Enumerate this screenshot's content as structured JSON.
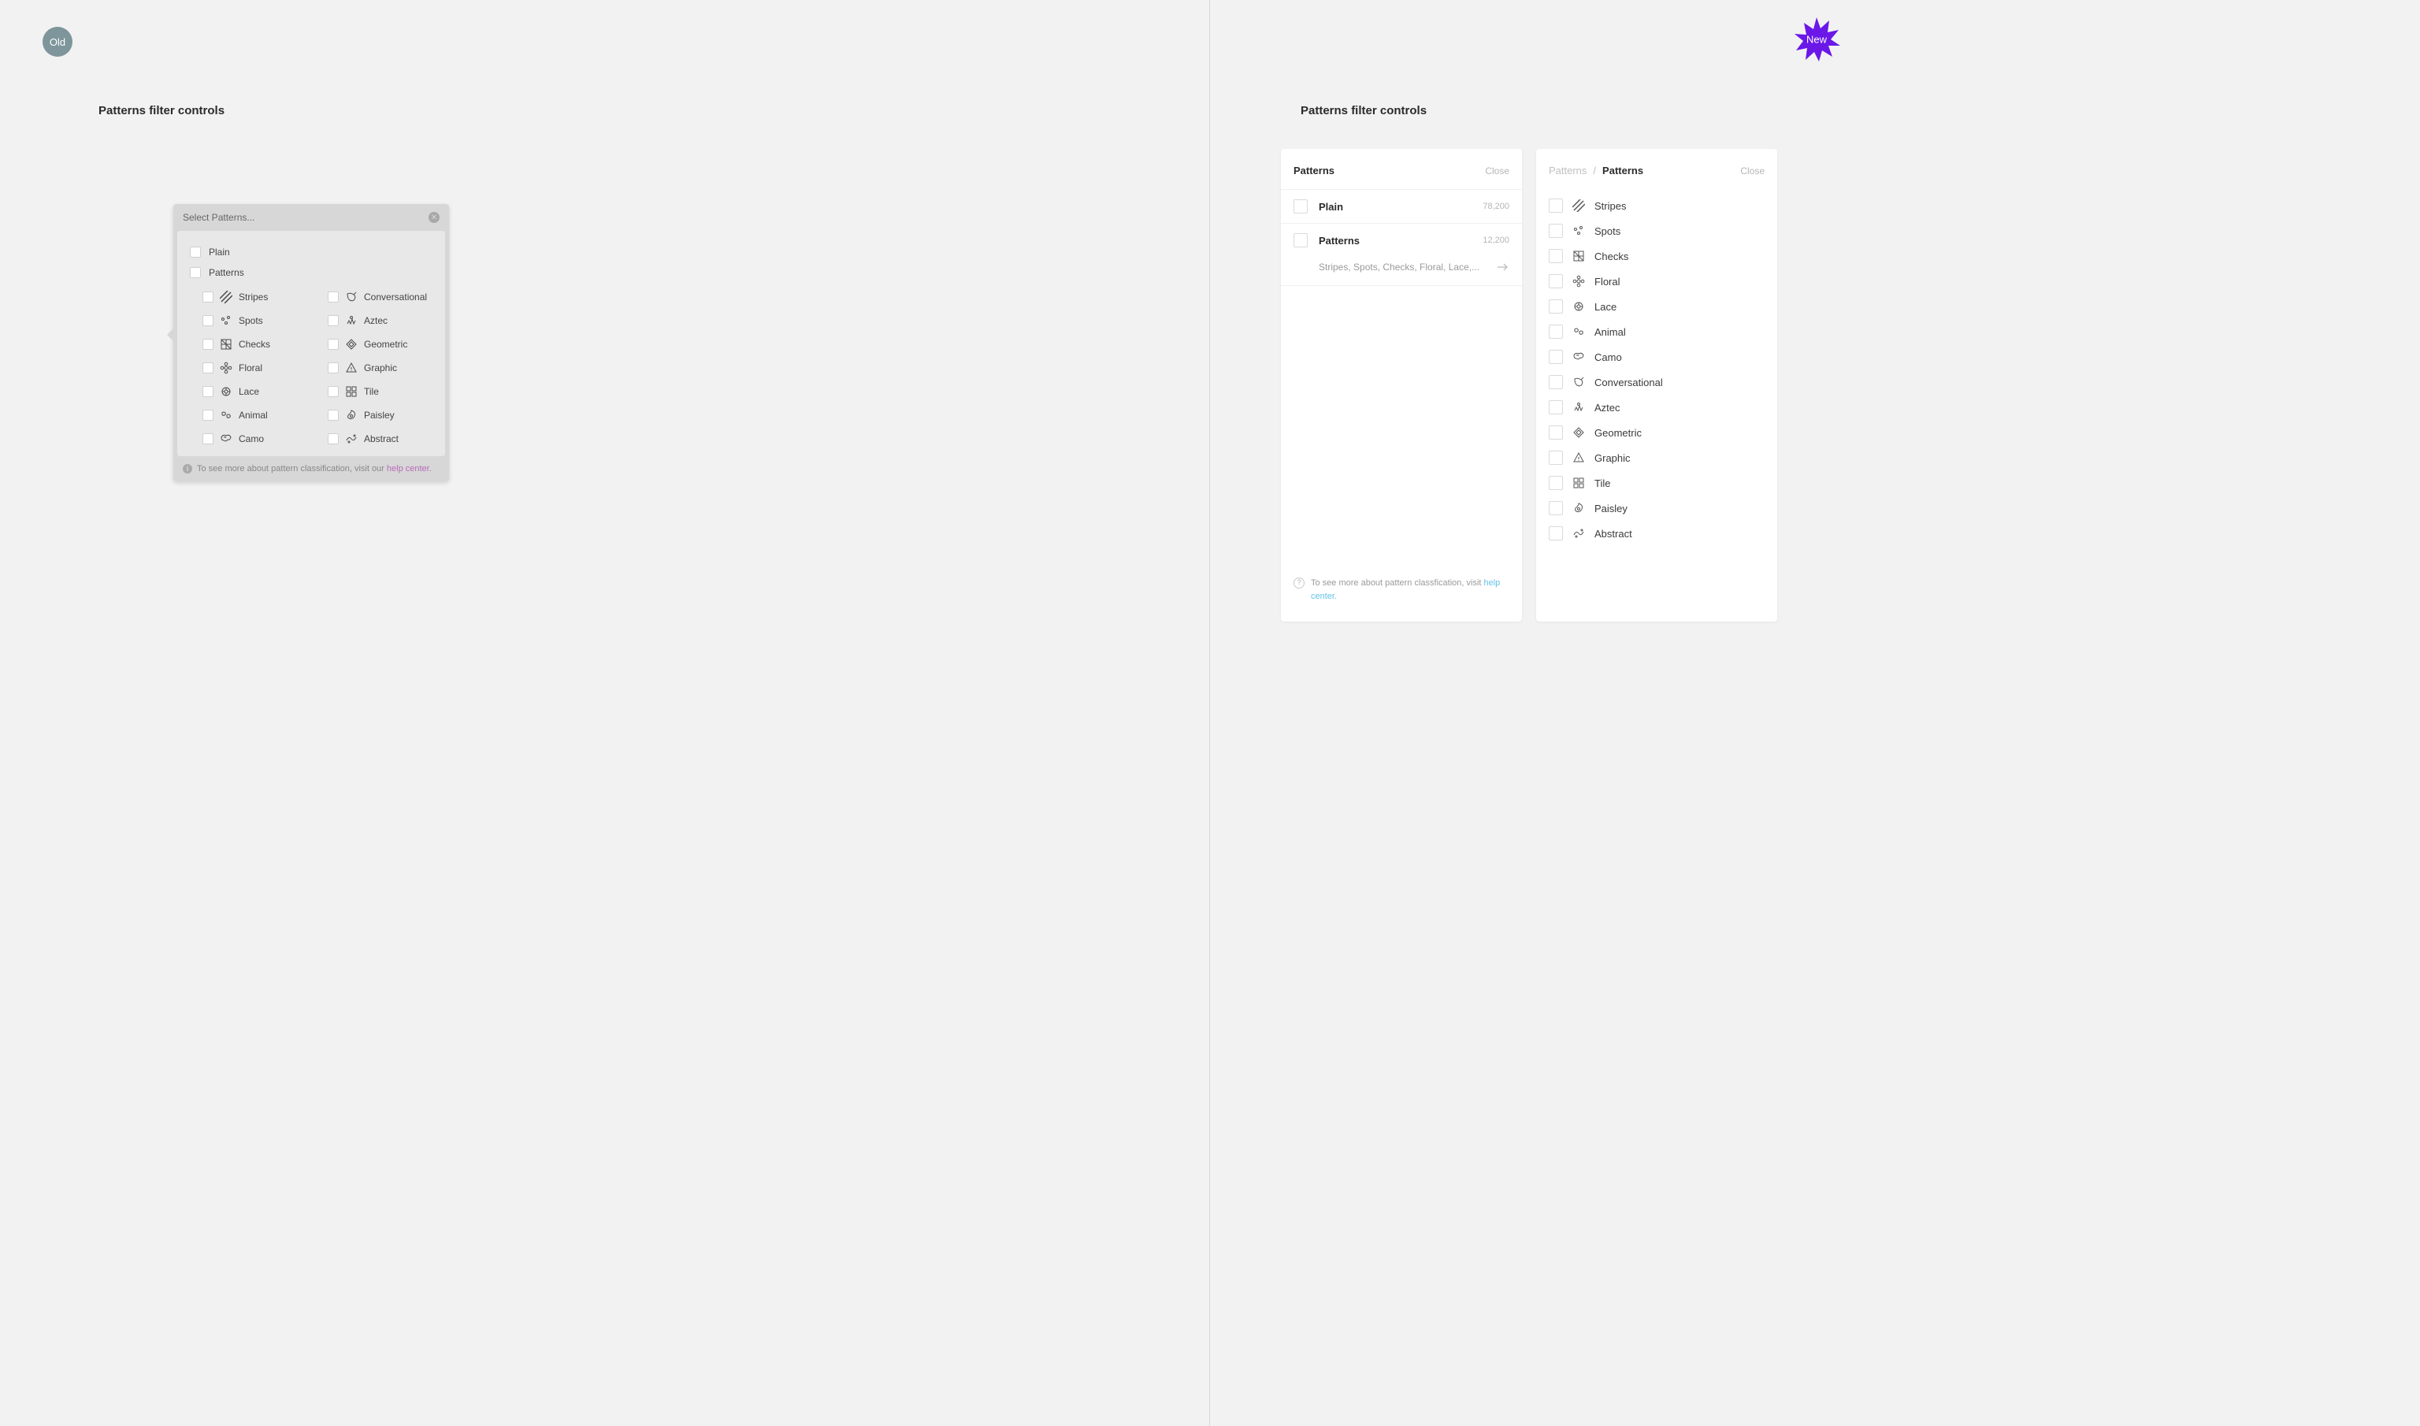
{
  "badges": {
    "old": "Old",
    "new": "New"
  },
  "title": "Patterns filter controls",
  "old_panel": {
    "header": "Select Patterns...",
    "plain": "Plain",
    "patterns": "Patterns",
    "left_col": [
      "Stripes",
      "Spots",
      "Checks",
      "Floral",
      "Lace",
      "Animal",
      "Camo"
    ],
    "right_col": [
      "Conversational",
      "Aztec",
      "Geometric",
      "Graphic",
      "Tile",
      "Paisley",
      "Abstract"
    ],
    "footer_text": "To see more about pattern classification, visit our ",
    "footer_link": "help center."
  },
  "new_panel1": {
    "title": "Patterns",
    "close": "Close",
    "rows": [
      {
        "label": "Plain",
        "count": "78,200"
      },
      {
        "label": "Patterns",
        "count": "12,200"
      }
    ],
    "subline": "Stripes, Spots, Checks, Floral, Lace,...",
    "footer_text": "To see more about pattern classfication, visit ",
    "footer_link": "help center."
  },
  "new_panel2": {
    "bc_parent": "Patterns",
    "bc_current": "Patterns",
    "close": "Close",
    "items": [
      "Stripes",
      "Spots",
      "Checks",
      "Floral",
      "Lace",
      "Animal",
      "Camo",
      "Conversational",
      "Aztec",
      "Geometric",
      "Graphic",
      "Tile",
      "Paisley",
      "Abstract"
    ]
  },
  "icons": {
    "Stripes": "stripes",
    "Spots": "spots",
    "Checks": "checks",
    "Floral": "floral",
    "Lace": "lace",
    "Animal": "animal",
    "Camo": "camo",
    "Conversational": "conversational",
    "Aztec": "aztec",
    "Geometric": "geometric",
    "Graphic": "graphic",
    "Tile": "tile",
    "Paisley": "paisley",
    "Abstract": "abstract"
  }
}
